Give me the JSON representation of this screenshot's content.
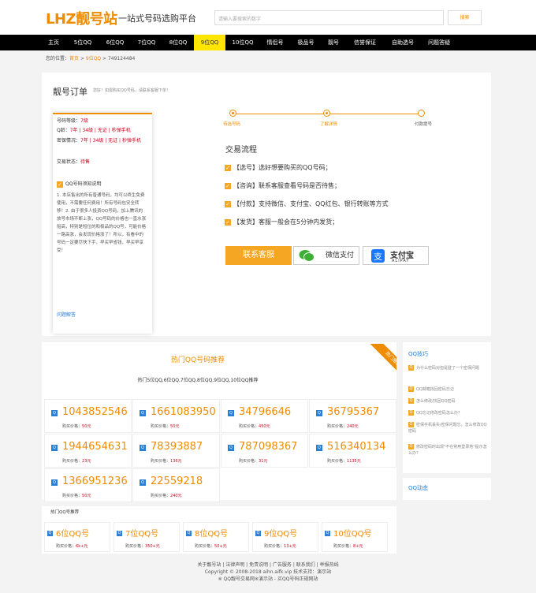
{
  "header": {
    "logo_en": "LHZ",
    "logo_cn": "靓号站",
    "slogan": "一站式号码选购平台",
    "search_placeholder": "请输入要搜索的数字",
    "search_button": "搜索"
  },
  "nav": {
    "items": [
      "主页",
      "5位QQ",
      "6位QQ",
      "7位QQ",
      "8位QQ",
      "9位QQ",
      "10位QQ",
      "情侣号",
      "极品号",
      "靓号",
      "信誉保证",
      "自助选号",
      "问题答疑"
    ],
    "active": "9位QQ"
  },
  "breadcrumb": {
    "prefix": "您的位置：",
    "home": "首页",
    "sep1": " > ",
    "category": "9位QQ",
    "sep2": " > ",
    "current": "749124484"
  },
  "order": {
    "title": "靓号订单",
    "subtitle": "您好！如需购买QQ号码，请联系客服下单！",
    "level_label": "号码等级：",
    "level_value": "7级",
    "qage_label": "Q龄：",
    "qage_value": "7年 | 34级 | 无证 | 秒弹手机",
    "secret_label": "密保情况：",
    "secret_value": "7年 | 34级 | 无证 | 秒弹手机",
    "status_label": "交易状态：",
    "status_value": "待售",
    "desc_title": "QQ号码须知说明",
    "desc_text": "1. 本店售出的所有普通号码，均可以终生免费使用，不需要任何费用！所有号码包安全转移！2. 由于很多人投资QQ号码，加上腾讯的放号市场不断上涨，QQ号码的价格也一直水涨船高，特别是短位的和极品的QQ号，可能价格一路高涨，会发现价格涨了！所以，有看中的号码一定要尽快下手，早买早省钱，早买早享受！",
    "faq_link": "问题解答",
    "steps": [
      "待选号码",
      "了解详情",
      "付款提号"
    ],
    "flow_title": "交易流程",
    "flow_items": [
      "【选号】选好想要购买的QQ号码；",
      "【咨询】联系客服查看号码是否待售；",
      "【付款】支持微信、支付宝、QQ红包、银行转账等方式",
      "【发货】客服一般会在5分钟内发货；"
    ],
    "btn_contact": "联系客服",
    "btn_wechat": "微信支付",
    "btn_alipay_cn": "支付宝",
    "btn_alipay_en": "ALIPAY"
  },
  "hot": {
    "title": "热门QQ号码推荐",
    "ribbon": "热门推荐",
    "subtitle": "热门5位QQ,6位QQ,7位QQ,8位QQ,9位QQ,10位QQ推荐",
    "price_label": "购买价格：",
    "numbers": [
      {
        "num": "1043852546",
        "price": "50元"
      },
      {
        "num": "1661083950",
        "price": "50元"
      },
      {
        "num": "34796646",
        "price": "450元"
      },
      {
        "num": "36795367",
        "price": "240元"
      },
      {
        "num": "1944654631",
        "price": "23元"
      },
      {
        "num": "78393887",
        "price": "136元"
      },
      {
        "num": "787098367",
        "price": "31元"
      },
      {
        "num": "516340134",
        "price": "1135元"
      },
      {
        "num": "1366951236",
        "price": "50元"
      },
      {
        "num": "22559218",
        "price": "240元"
      }
    ]
  },
  "types": {
    "title": "热门QQ号推荐",
    "price_label": "购买价格：",
    "items": [
      {
        "name": "6位QQ号",
        "price": "6k+元"
      },
      {
        "name": "7位QQ号",
        "price": "350+元"
      },
      {
        "name": "8位QQ号",
        "price": "50+元"
      },
      {
        "name": "9位QQ号",
        "price": "13+元"
      },
      {
        "name": "10位QQ号",
        "price": "8+元"
      }
    ]
  },
  "skill": {
    "title": "QQ技巧",
    "items": [
      "为什么密码对但是登了一个密保问题",
      "QQ邮箱找回密码忘记",
      "怎么修改/找回QQ密码",
      "QQ忘记修改密码怎么办？",
      "密保手机丢失/密保问题忘，怎么修改QQ密码",
      "修改密码时出现\"不在常用登录地\"提示怎么办？"
    ]
  },
  "dyn": {
    "title": "QQ动态"
  },
  "footer": {
    "line1": "关于靓号站 | 法律声明 | 免责说明 | 广告服务 | 联系我们 | 举报热线",
    "line2": "Copyright © 2008-2018 aihn.aifk.vip 技术支持：演示站",
    "line3": "※ QQ靓号交易网※演示站 - 买QQ号码正规网站"
  },
  "colors": {
    "accent": "#f08c00",
    "nav_bg": "#000000",
    "nav_active": "#ffe500",
    "link_blue": "#2a7fd4",
    "price_red": "#d0021b"
  }
}
